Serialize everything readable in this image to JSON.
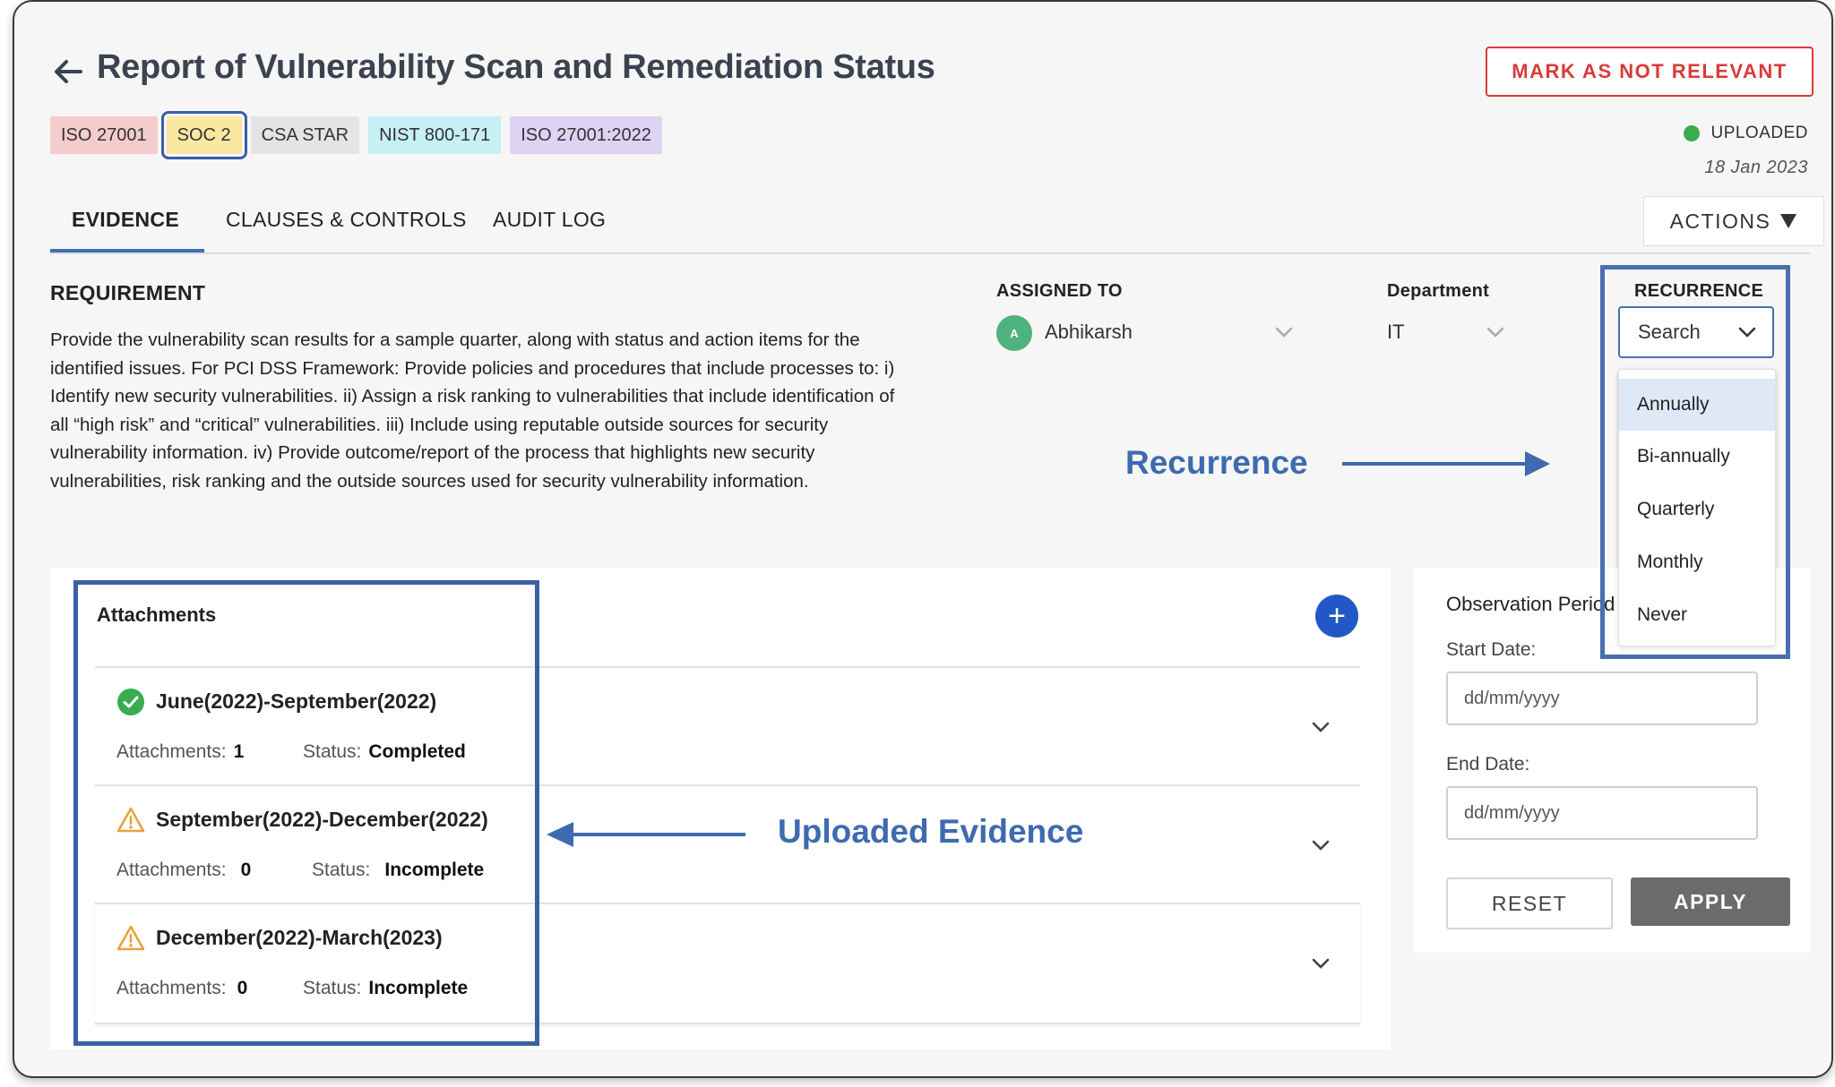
{
  "header": {
    "title": "Report of Vulnerability Scan and Remediation Status",
    "mark_button": "MARK AS NOT RELEVANT",
    "status": "UPLOADED",
    "status_date": "18 Jan 2023"
  },
  "tags": [
    "ISO 27001",
    "SOC 2",
    "CSA STAR",
    "NIST 800-171",
    "ISO 27001:2022"
  ],
  "tabs": [
    "EVIDENCE",
    "CLAUSES & CONTROLS",
    "AUDIT LOG"
  ],
  "actions_label": "ACTIONS",
  "requirement": {
    "heading": "REQUIREMENT",
    "text": "Provide the vulnerability scan results for a sample quarter, along with status and action items for the identified issues. For PCI DSS Framework: Provide policies and procedures that include processes to: i) Identify new security vulnerabilities. ii) Assign a risk ranking to vulnerabilities that include identification of all “high risk” and “critical” vulnerabilities. iii) Include using reputable outside sources for security vulnerability information. iv) Provide outcome/report of the process that highlights new security vulnerabilities, risk ranking and the outside sources used for security vulnerability information."
  },
  "assigned": {
    "label": "ASSIGNED TO",
    "avatar": "A",
    "name": "Abhikarsh"
  },
  "department": {
    "label": "Department",
    "value": "IT"
  },
  "recurrence": {
    "label": "RECURRENCE",
    "value": "Search",
    "options": [
      "Annually",
      "Bi-annually",
      "Quarterly",
      "Monthly",
      "Never"
    ]
  },
  "annotations": {
    "recurrence": "Recurrence",
    "uploaded": "Uploaded Evidence"
  },
  "attachments": {
    "title": "Attachments",
    "count_label": "Attachments:",
    "status_label": "Status:",
    "rows": [
      {
        "period": "June(2022)-September(2022)",
        "count": "1",
        "status": "Completed",
        "icon": "check-circle-icon"
      },
      {
        "period": "September(2022)-December(2022)",
        "count": "0",
        "status": "Incomplete",
        "icon": "warning-icon"
      },
      {
        "period": "December(2022)-March(2023)",
        "count": "0",
        "status": "Incomplete",
        "icon": "warning-icon"
      }
    ]
  },
  "observation": {
    "title": "Observation Period",
    "start_label": "Start Date:",
    "end_label": "End Date:",
    "placeholder": "dd/mm/yyyy",
    "reset": "RESET",
    "apply": "APPLY"
  },
  "colors": {
    "accent": "#3d6bb0",
    "danger": "#d93a3a",
    "success": "#3aab4f",
    "warning": "#e8a23a",
    "tag_iso": "#f4cccc",
    "tag_soc": "#fbe6a2",
    "tag_csa": "#e4e4e4",
    "tag_nist": "#c6f0f5",
    "tag_iso2022": "#ddd3f3"
  }
}
